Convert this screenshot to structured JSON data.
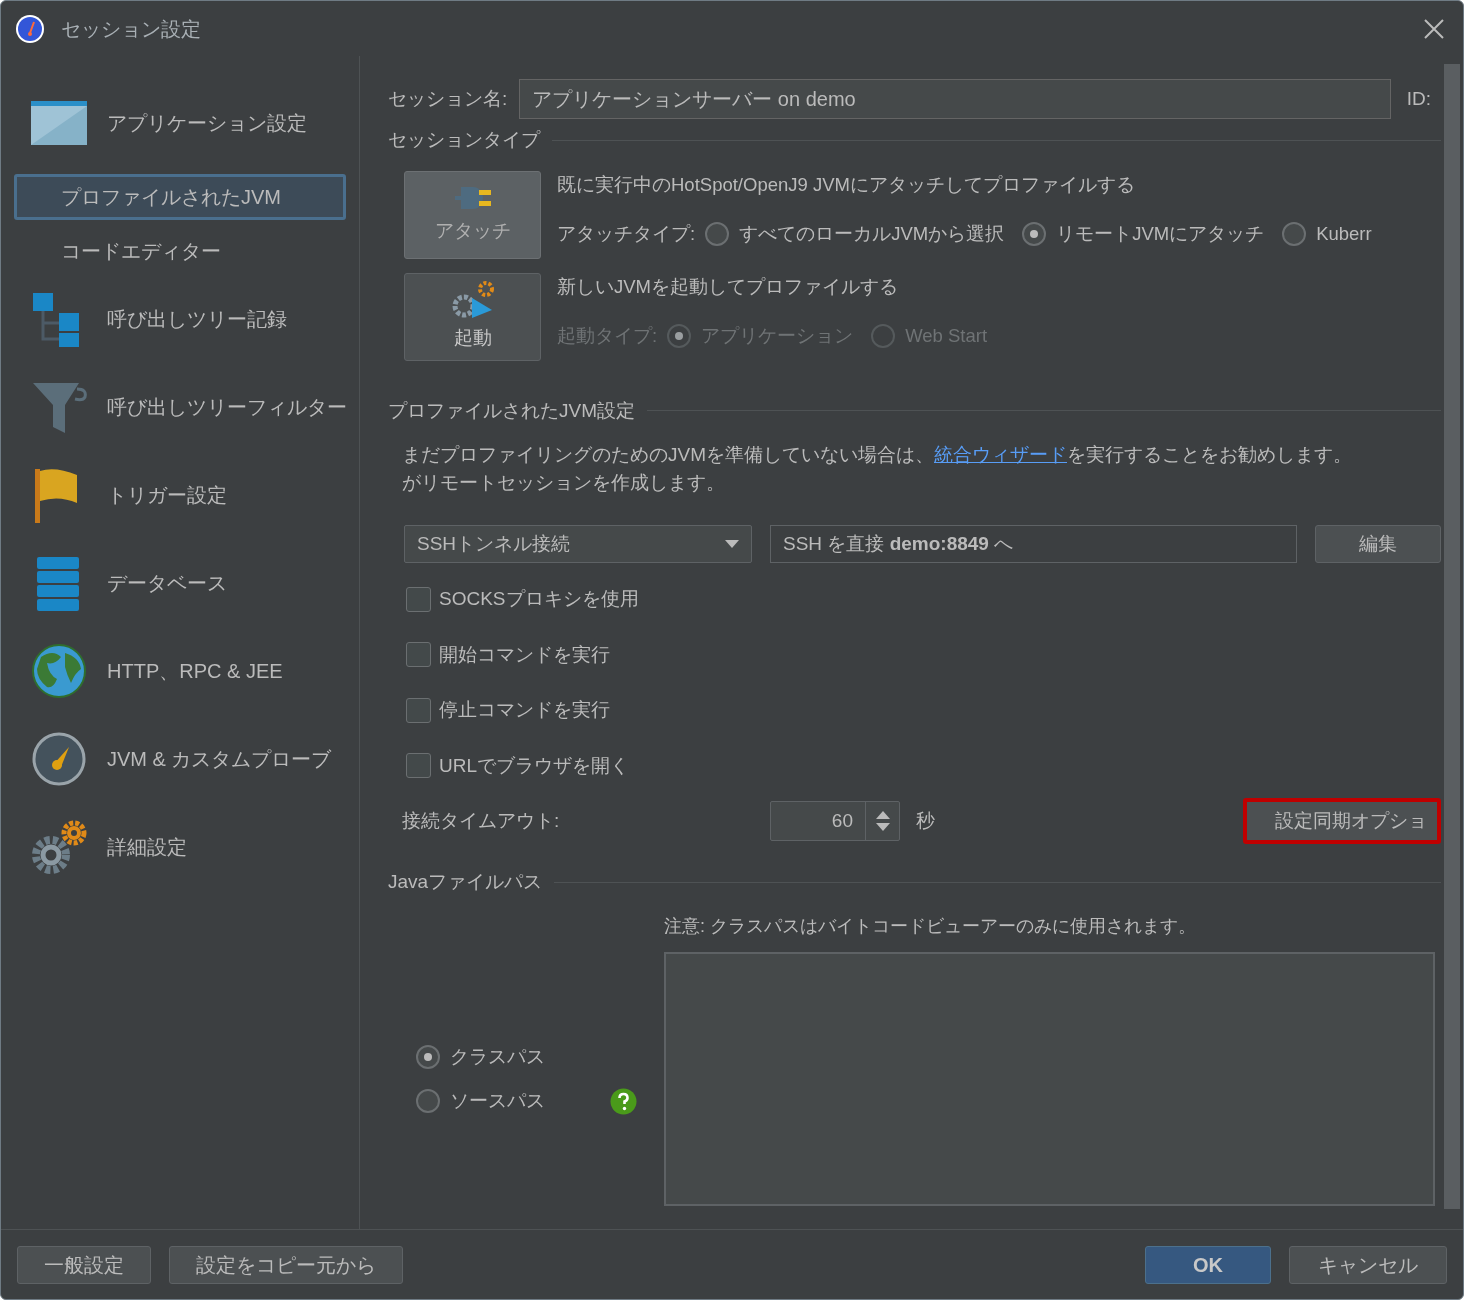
{
  "window": {
    "title": "セッション設定"
  },
  "sidebar": {
    "items": [
      {
        "label": "アプリケーション設定",
        "kind": "window",
        "selected": false,
        "children": [
          {
            "label": "プロファイルされたJVM",
            "selected": true
          },
          {
            "label": "コードエディター",
            "selected": false
          }
        ]
      },
      {
        "label": "呼び出しツリー記録",
        "kind": "tree",
        "selected": false
      },
      {
        "label": "呼び出しツリーフィルター",
        "kind": "funnel",
        "selected": false
      },
      {
        "label": "トリガー設定",
        "kind": "flag",
        "selected": false
      },
      {
        "label": "データベース",
        "kind": "database",
        "selected": false
      },
      {
        "label": "HTTP、RPC & JEE",
        "kind": "globe",
        "selected": false
      },
      {
        "label": "JVM & カスタムプローブ",
        "kind": "gauge",
        "selected": false
      },
      {
        "label": "詳細設定",
        "kind": "gears",
        "selected": false
      }
    ]
  },
  "session_name": {
    "label": "セッション名:",
    "value": "アプリケーションサーバー on demo",
    "id_label": "ID:"
  },
  "session_type": {
    "title": "セッションタイプ",
    "options": [
      {
        "button": "アタッチ",
        "kind": "plug",
        "selected": true,
        "description": "既に実行中のHotSpot/OpenJ9 JVMにアタッチしてプロファイルする",
        "type_label": "アタッチタイプ:",
        "radios": [
          {
            "label": "すべてのローカルJVMから選択",
            "selected": false
          },
          {
            "label": "リモートJVMにアタッチ",
            "selected": true
          },
          {
            "label": "Kuberr",
            "selected": false
          }
        ]
      },
      {
        "button": "起動",
        "kind": "gear-arrow",
        "selected": false,
        "description": "新しいJVMを起動してプロファイルする",
        "type_label": "起動タイプ:",
        "radios": [
          {
            "label": "アプリケーション",
            "selected": true
          },
          {
            "label": "Web Start",
            "selected": false
          }
        ]
      }
    ]
  },
  "jvm_settings": {
    "title": "プロファイルされたJVM設定",
    "note_before": "まだプロファイリングのためのJVMを準備していない場合は、",
    "link": "統合ウィザード",
    "note_after": "を実行することをお勧めします。",
    "note_line2": "がリモートセッションを作成します。",
    "connection": "SSHトンネル接続",
    "target": "SSH を直接 **demo:8849** へ",
    "edit_button": "編集",
    "checkboxes": [
      {
        "label": "SOCKSプロキシを使用",
        "checked": false
      },
      {
        "label": "開始コマンドを実行",
        "checked": false
      },
      {
        "label": "停止コマンドを実行",
        "checked": false
      },
      {
        "label": "URLでブラウザを開く",
        "checked": false
      }
    ],
    "timeout": {
      "label": "接続タイムアウト:",
      "value": "60",
      "unit": "秒"
    },
    "sync_button": {
      "label": "設定同期オプショ",
      "highlighted": true
    }
  },
  "java_paths": {
    "title": "Javaファイルパス",
    "note": "注意: クラスパスはバイトコードビューアーのみに使用されます。",
    "radios": [
      {
        "label": "クラスパス",
        "selected": true
      },
      {
        "label": "ソースパス",
        "selected": false
      }
    ]
  },
  "footer": {
    "left_buttons": [
      "一般設定",
      "設定をコピー元から"
    ],
    "ok": "OK",
    "cancel": "キャンセル"
  }
}
